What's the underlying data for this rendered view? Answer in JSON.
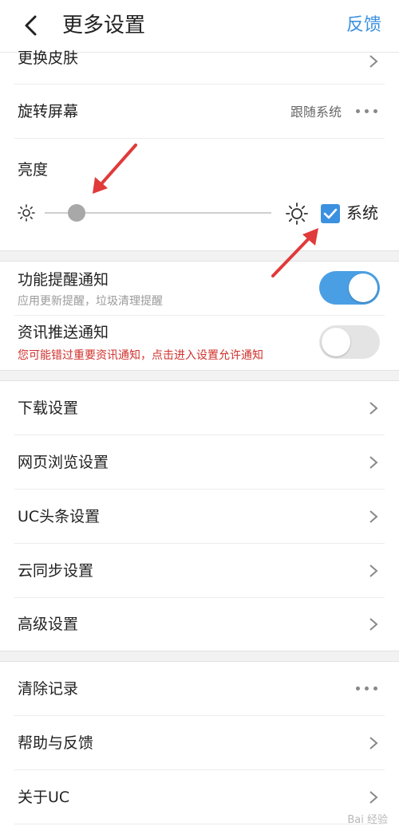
{
  "header": {
    "title": "更多设置",
    "feedback": "反馈"
  },
  "rows": {
    "skin": "更换皮肤",
    "rotate": {
      "label": "旋转屏幕",
      "value": "跟随系统"
    },
    "brightness": {
      "label": "亮度",
      "system_label": "系统",
      "system_checked": true,
      "level": 0.14
    },
    "feature_notice": {
      "label": "功能提醒通知",
      "sub": "应用更新提醒，垃圾清理提醒",
      "on": true
    },
    "news_notice": {
      "label": "资讯推送通知",
      "sub": "您可能错过重要资讯通知，点击进入设置允许通知",
      "on": false
    },
    "download": "下载设置",
    "browse": "网页浏览设置",
    "uc_headline": "UC头条设置",
    "cloud_sync": "云同步设置",
    "advanced": "高级设置",
    "clear": "清除记录",
    "help": "帮助与反馈",
    "about": "关于UC"
  },
  "watermark": "Bai 经验",
  "colors": {
    "accent": "#3b91e0",
    "warning": "#d0312d",
    "annotation_arrow": "#e03a3a"
  }
}
